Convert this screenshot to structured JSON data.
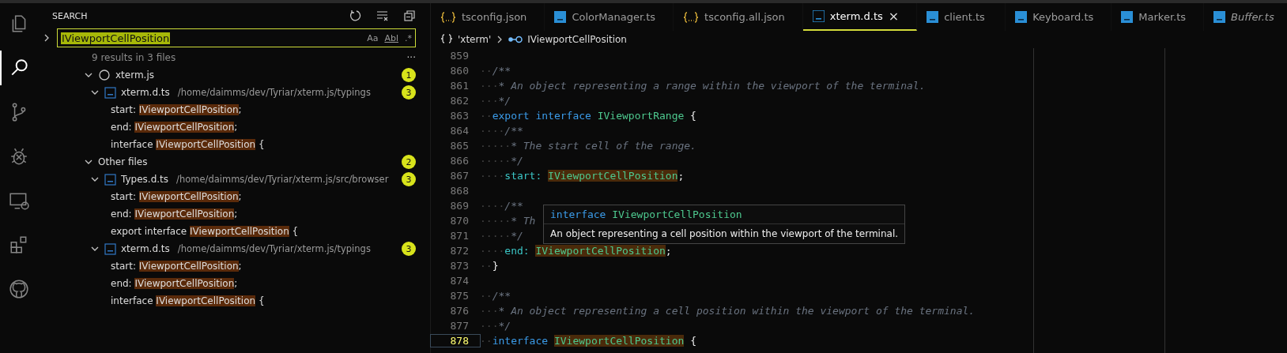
{
  "activity_bar": [
    {
      "selected": false
    },
    {
      "selected": true
    },
    {
      "selected": false
    },
    {
      "selected": false
    },
    {
      "selected": false
    },
    {
      "selected": false
    },
    {
      "selected": false
    }
  ],
  "sidebar": {
    "title": "SEARCH",
    "search": {
      "value": "IViewportCellPosition",
      "options": [
        "Aa",
        "Abl",
        ".*"
      ]
    },
    "summary": "9 results in 3 files",
    "more": "···",
    "groups": [
      {
        "name": "xterm.js",
        "badge": "1",
        "expanded": true,
        "files": [
          {
            "name": "xterm.d.ts",
            "path": "/home/daimms/dev/Tyriar/xterm.js/typings",
            "badge": "3",
            "expanded": true,
            "matches": [
              {
                "before": "start: ",
                "match": "IViewportCellPosition",
                "after": ";"
              },
              {
                "before": "end: ",
                "match": "IViewportCellPosition",
                "after": ";"
              },
              {
                "before": "interface ",
                "match": "IViewportCellPosition",
                "after": " {"
              }
            ]
          }
        ]
      },
      {
        "name": "Other files",
        "badge": "2",
        "expanded": true,
        "files": [
          {
            "name": "Types.d.ts",
            "path": "/home/daimms/dev/Tyriar/xterm.js/src/browser",
            "badge": "3",
            "expanded": true,
            "matches": [
              {
                "before": "start: ",
                "match": "IViewportCellPosition",
                "after": ";"
              },
              {
                "before": "end: ",
                "match": "IViewportCellPosition",
                "after": ";"
              },
              {
                "before": "export interface ",
                "match": "IViewportCellPosition",
                "after": " {"
              }
            ]
          },
          {
            "name": "xterm.d.ts",
            "path": "/home/daimms/dev/Tyriar/xterm.js/typings",
            "badge": "3",
            "expanded": true,
            "matches": [
              {
                "before": "start: ",
                "match": "IViewportCellPosition",
                "after": ";"
              },
              {
                "before": "end: ",
                "match": "IViewportCellPosition",
                "after": ";"
              },
              {
                "before": "interface ",
                "match": "IViewportCellPosition",
                "after": " {"
              }
            ]
          }
        ]
      }
    ]
  },
  "tabs": [
    {
      "label": "tsconfig.json",
      "kind": "json",
      "selected": false,
      "preview": false
    },
    {
      "label": "ColorManager.ts",
      "kind": "ts",
      "selected": false,
      "preview": false
    },
    {
      "label": "tsconfig.all.json",
      "kind": "json",
      "selected": false,
      "preview": false
    },
    {
      "label": "xterm.d.ts",
      "kind": "ts",
      "selected": true,
      "preview": false,
      "close": "×"
    },
    {
      "label": "client.ts",
      "kind": "ts",
      "selected": false,
      "preview": false
    },
    {
      "label": "Keyboard.ts",
      "kind": "ts",
      "selected": false,
      "preview": false
    },
    {
      "label": "Marker.ts",
      "kind": "ts",
      "selected": false,
      "preview": false
    },
    {
      "label": "Buffer.ts",
      "kind": "ts",
      "selected": false,
      "preview": true
    }
  ],
  "breadcrumbs": [
    {
      "kind": "module",
      "label": "'xterm'"
    },
    {
      "kind": "interface",
      "label": "IViewportCellPosition"
    }
  ],
  "code": [
    {
      "number": "859",
      "current": false
    },
    {
      "number": "860",
      "current": false,
      "tokens": [
        {
          "kind": "ws",
          "text": "··"
        },
        {
          "kind": "comment",
          "text": "/**"
        }
      ]
    },
    {
      "number": "861",
      "current": false,
      "tokens": [
        {
          "kind": "ws",
          "text": "···"
        },
        {
          "kind": "comment",
          "text": "* An object representing a range within the viewport of the terminal."
        }
      ]
    },
    {
      "number": "862",
      "current": false,
      "tokens": [
        {
          "kind": "ws",
          "text": "···"
        },
        {
          "kind": "comment",
          "text": "*/"
        }
      ]
    },
    {
      "number": "863",
      "current": false,
      "tokens": [
        {
          "kind": "ws",
          "text": "··"
        },
        {
          "kind": "keyword",
          "text": "export interface "
        },
        {
          "kind": "type",
          "text": "IViewportRange"
        },
        {
          "kind": "punct",
          "text": " {"
        }
      ]
    },
    {
      "number": "864",
      "current": false,
      "tokens": [
        {
          "kind": "ws",
          "text": "····"
        },
        {
          "kind": "comment",
          "text": "/**"
        }
      ]
    },
    {
      "number": "865",
      "current": false,
      "tokens": [
        {
          "kind": "ws",
          "text": "·····"
        },
        {
          "kind": "comment",
          "text": "* The start cell of the range."
        }
      ]
    },
    {
      "number": "866",
      "current": false,
      "tokens": [
        {
          "kind": "ws",
          "text": "·····"
        },
        {
          "kind": "comment",
          "text": "*/"
        }
      ]
    },
    {
      "number": "867",
      "current": false,
      "tokens": [
        {
          "kind": "ws",
          "text": "····"
        },
        {
          "kind": "prop",
          "text": "start: "
        },
        {
          "kind": "match",
          "text": "IViewportCellPosition"
        },
        {
          "kind": "punct",
          "text": ";"
        }
      ]
    },
    {
      "number": "868",
      "current": false
    },
    {
      "number": "869",
      "current": false,
      "tokens": [
        {
          "kind": "ws",
          "text": "····"
        },
        {
          "kind": "comment",
          "text": "/**"
        }
      ]
    },
    {
      "number": "870",
      "current": false,
      "tokens": [
        {
          "kind": "ws",
          "text": "·····"
        },
        {
          "kind": "comment",
          "text": "* Th"
        }
      ]
    },
    {
      "number": "871",
      "current": false,
      "tokens": [
        {
          "kind": "ws",
          "text": "·····"
        },
        {
          "kind": "comment",
          "text": "*/"
        }
      ]
    },
    {
      "number": "872",
      "current": false,
      "tokens": [
        {
          "kind": "ws",
          "text": "····"
        },
        {
          "kind": "prop",
          "text": "end: "
        },
        {
          "kind": "match",
          "text": "IViewportCellPosition"
        },
        {
          "kind": "punct",
          "text": ";"
        }
      ]
    },
    {
      "number": "873",
      "current": false,
      "tokens": [
        {
          "kind": "ws",
          "text": "··"
        },
        {
          "kind": "punct",
          "text": "}"
        }
      ]
    },
    {
      "number": "874",
      "current": false
    },
    {
      "number": "875",
      "current": false,
      "tokens": [
        {
          "kind": "ws",
          "text": "··"
        },
        {
          "kind": "comment",
          "text": "/**"
        }
      ]
    },
    {
      "number": "876",
      "current": false,
      "tokens": [
        {
          "kind": "ws",
          "text": "···"
        },
        {
          "kind": "comment",
          "text": "* An object representing a cell position within the viewport of the terminal."
        }
      ]
    },
    {
      "number": "877",
      "current": false,
      "tokens": [
        {
          "kind": "ws",
          "text": "···"
        },
        {
          "kind": "comment",
          "text": "*/"
        }
      ]
    },
    {
      "number": "878",
      "current": true,
      "tokens": [
        {
          "kind": "ws",
          "text": "··"
        },
        {
          "kind": "keyword",
          "text": "interface "
        },
        {
          "kind": "match",
          "text": "IViewportCellPosition"
        },
        {
          "kind": "punct",
          "text": " {"
        }
      ]
    }
  ],
  "hover": {
    "keyword": "interface",
    "name": "IViewportCellPosition",
    "description": "An object representing a cell position within the viewport of the terminal."
  }
}
